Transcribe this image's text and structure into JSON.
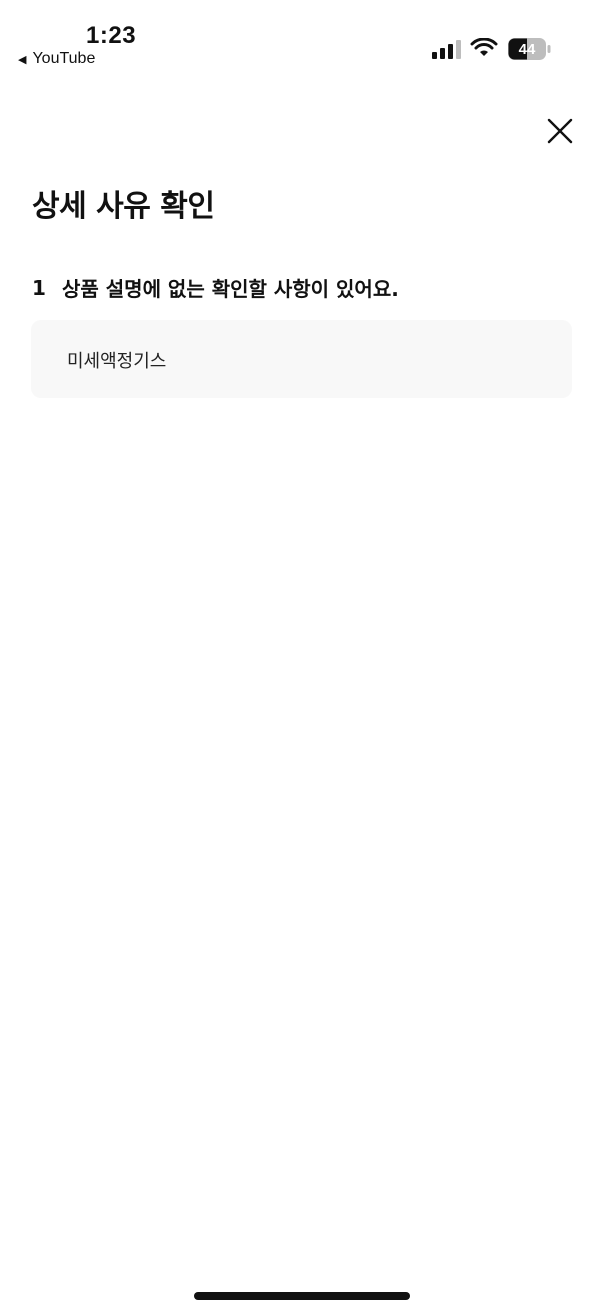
{
  "status_bar": {
    "time": "1:23",
    "back_app": "YouTube",
    "back_icon": "back-triangle-icon",
    "battery_level": "44",
    "icons": [
      "cellular-signal-icon",
      "wifi-icon",
      "battery-icon"
    ]
  },
  "header": {
    "close_icon": "close-icon",
    "title": "상세 사유 확인"
  },
  "reason": {
    "number": "1",
    "label": "상품 설명에 없는 확인할 사항이 있어요.",
    "detail": "미세액정기스"
  },
  "colors": {
    "background": "#ffffff",
    "text": "#111111",
    "detail_box": "#f8f8f8"
  }
}
